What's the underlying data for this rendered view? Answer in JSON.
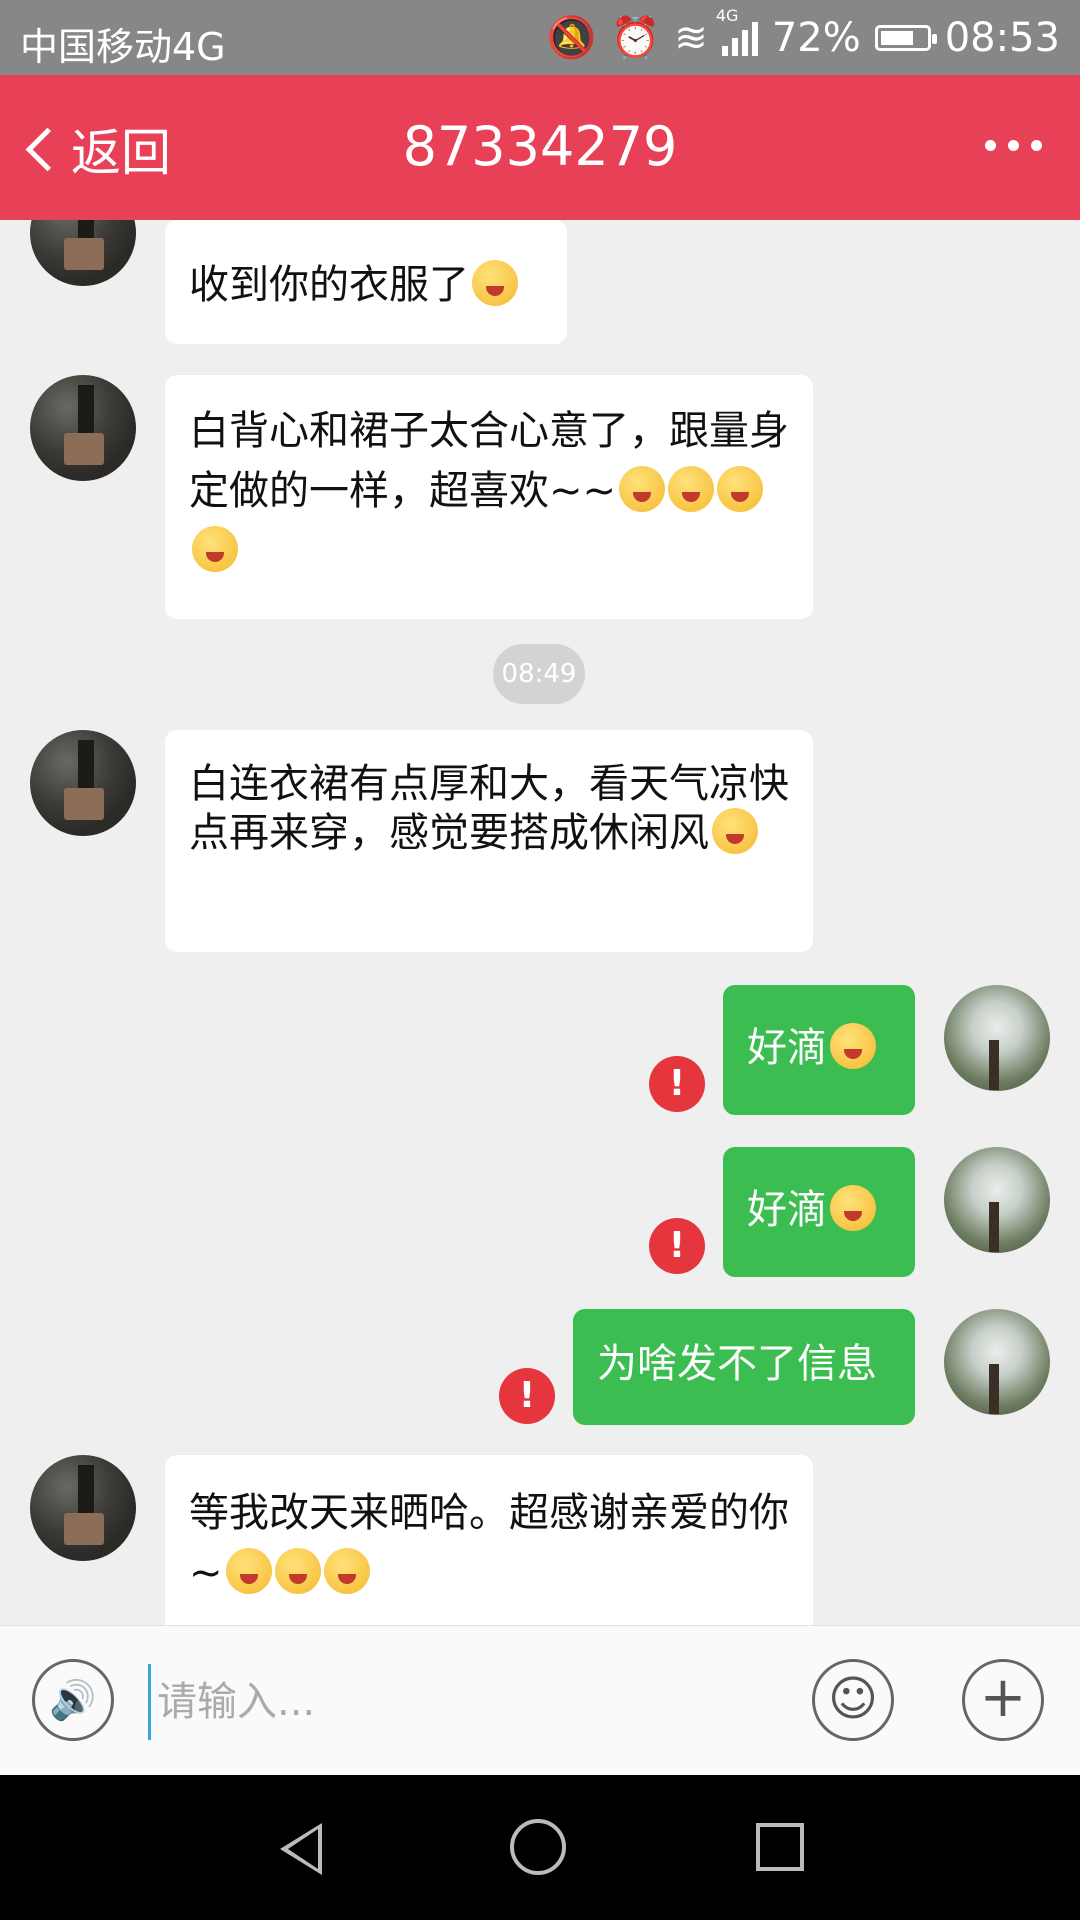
{
  "status_bar": {
    "carrier": "中国移动4G",
    "net_type": "4G",
    "battery": "72%",
    "battery_level": 0.72,
    "time": "08:53"
  },
  "header": {
    "back_label": "返回",
    "title": "87334279"
  },
  "messages": [
    {
      "side": "in",
      "text": "收到你的衣服了",
      "emojis": 1
    },
    {
      "side": "in",
      "text": "白背心和裙子太合心意了，跟量身定做的一样，超喜欢~~",
      "emojis": 4
    },
    {
      "side": "time",
      "text": "08:49"
    },
    {
      "side": "in",
      "text": "白连衣裙有点厚和大，看天气凉快点再来穿，感觉要搭成休闲风",
      "emojis": 1
    },
    {
      "side": "out",
      "text": "好滴",
      "emojis": 1,
      "failed": true
    },
    {
      "side": "out",
      "text": "好滴",
      "emojis": 1,
      "failed": true
    },
    {
      "side": "out",
      "text": "为啥发不了信息",
      "emojis": 0,
      "failed": true
    },
    {
      "side": "in",
      "text": "等我改天来晒哈。超感谢亲爱的你~",
      "emojis": 3
    }
  ],
  "fail_mark": "!",
  "input": {
    "placeholder": "请输入..."
  },
  "icons": {
    "voice": "voice-icon",
    "emoji": "emoji-icon",
    "plus": "plus-icon"
  },
  "colors": {
    "header": "#e84157",
    "outgoing": "#3cbd51",
    "fail": "#e5363e"
  }
}
